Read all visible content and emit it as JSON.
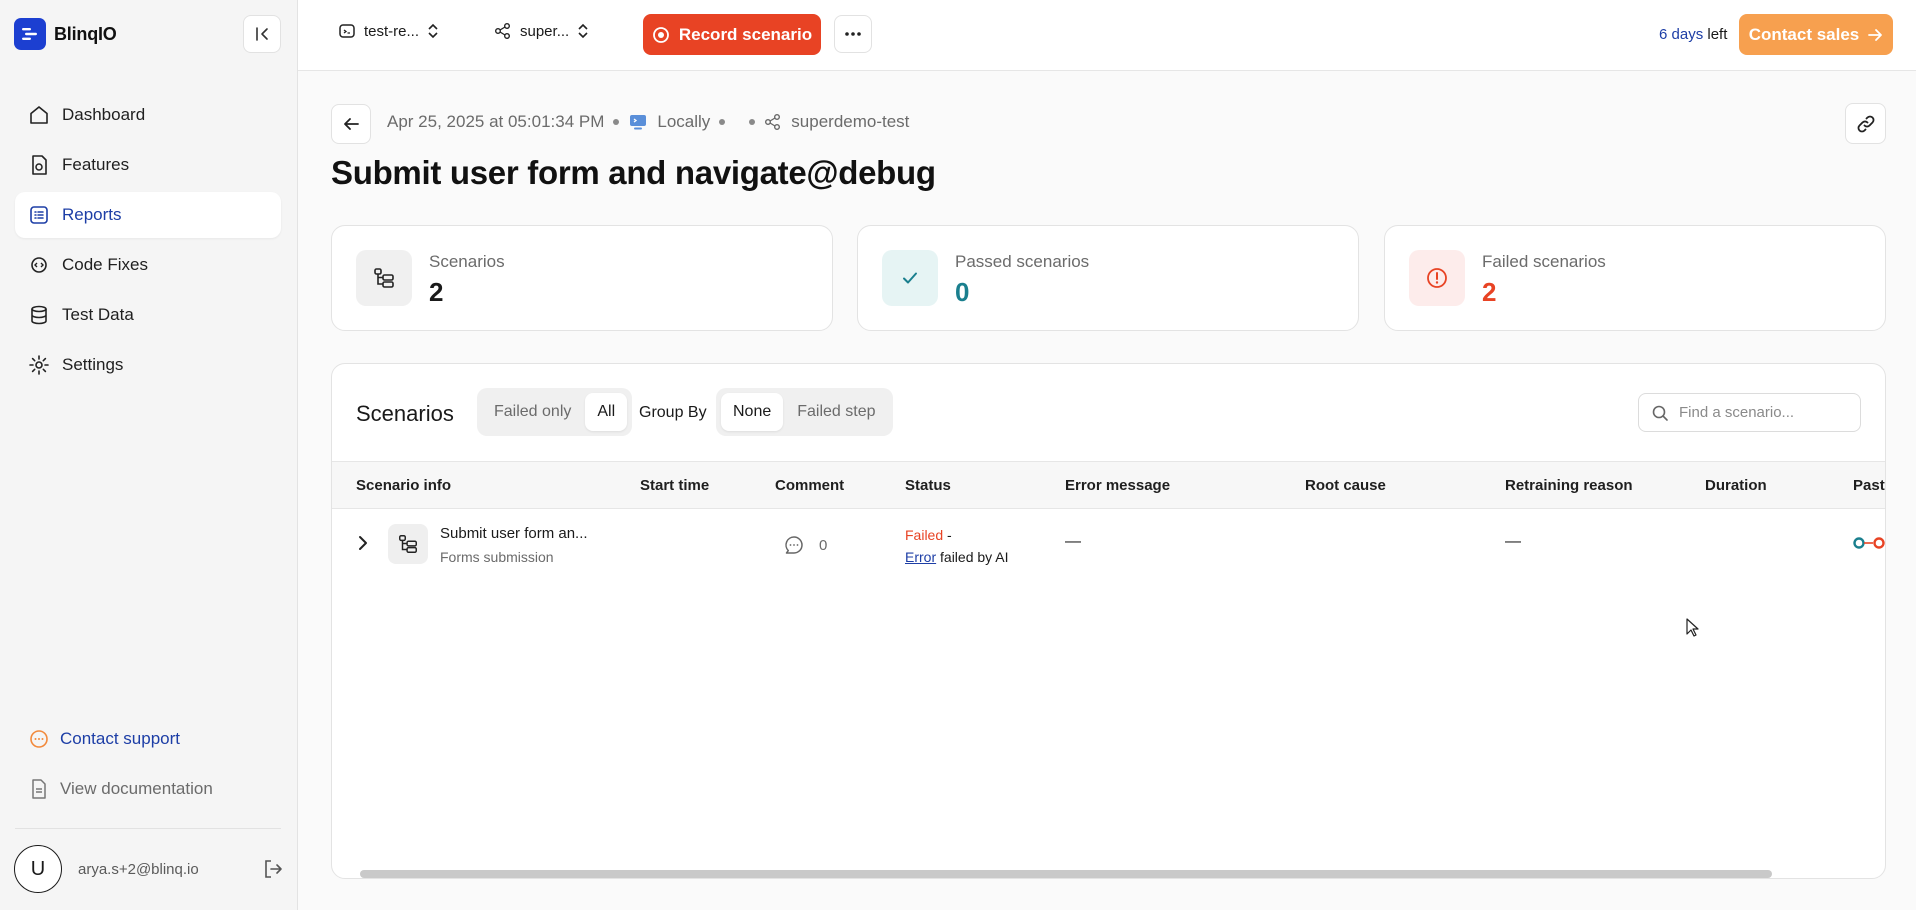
{
  "app": {
    "name": "BlinqIO",
    "accent": "#1d3ea6",
    "record_color": "#e84324",
    "contact_color": "#f7a04f"
  },
  "sidebar": {
    "items": [
      {
        "label": "Dashboard",
        "icon": "home-icon"
      },
      {
        "label": "Features",
        "icon": "features-icon"
      },
      {
        "label": "Reports",
        "icon": "reports-icon",
        "active": true
      },
      {
        "label": "Code Fixes",
        "icon": "code-fixes-icon"
      },
      {
        "label": "Test Data",
        "icon": "database-icon"
      },
      {
        "label": "Settings",
        "icon": "gear-icon"
      }
    ],
    "support_label": "Contact support",
    "docs_label": "View documentation",
    "user_initial": "U",
    "user_email": "arya.s+2@blinq.io"
  },
  "topbar": {
    "project": "test-re...",
    "environment": "super...",
    "record_label": "Record scenario",
    "trial_days": "6 days",
    "trial_suffix": "left",
    "contact_label": "Contact sales"
  },
  "report": {
    "datetime": "Apr 25, 2025 at 05:01:34 PM",
    "run_location": "Locally",
    "environment": "superdemo-test",
    "title": "Submit user form and navigate@debug"
  },
  "stats": {
    "scenarios": {
      "label": "Scenarios",
      "value": "2"
    },
    "passed": {
      "label": "Passed scenarios",
      "value": "0",
      "color": "#1a7f8e"
    },
    "failed": {
      "label": "Failed scenarios",
      "value": "2",
      "color": "#e84324"
    }
  },
  "scenarios_panel": {
    "title": "Scenarios",
    "filter": {
      "failed_only": "Failed only",
      "all": "All",
      "selected": "All"
    },
    "group_by_label": "Group By",
    "group": {
      "none": "None",
      "failed_step": "Failed step",
      "selected": "None"
    },
    "search_placeholder": "Find a scenario...",
    "columns": [
      "Scenario info",
      "Start time",
      "Comment",
      "Status",
      "Error message",
      "Root cause",
      "Retraining reason",
      "Duration",
      "Past"
    ],
    "rows": [
      {
        "name": "Submit user form an...",
        "feature": "Forms submission",
        "comments": "0",
        "status": "Failed",
        "status_sep": " -",
        "error_link": "Error",
        "error_suffix": " failed by AI",
        "error_message": "—",
        "retraining_reason": "—"
      }
    ]
  }
}
